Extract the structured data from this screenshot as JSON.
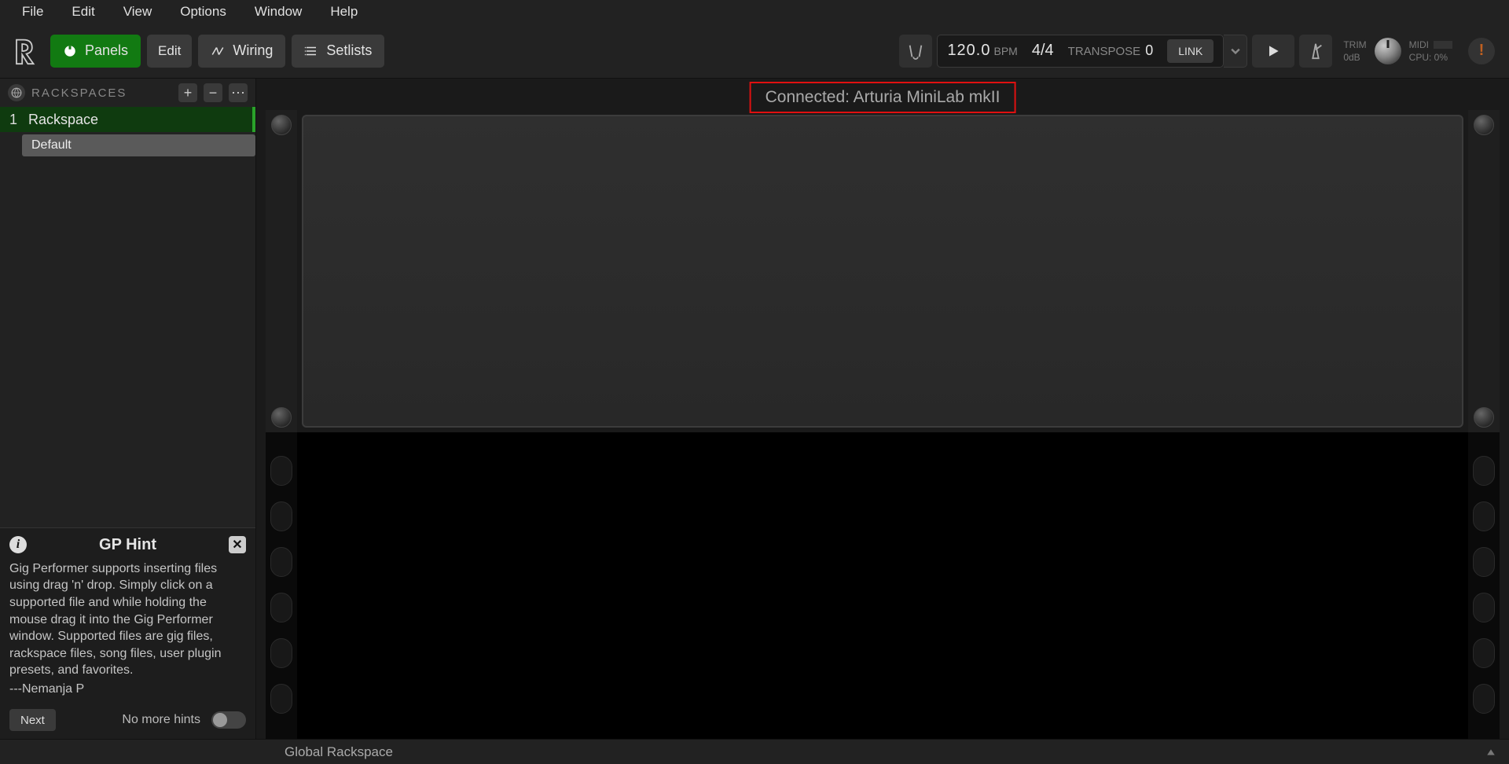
{
  "menu": {
    "items": [
      "File",
      "Edit",
      "View",
      "Options",
      "Window",
      "Help"
    ]
  },
  "toolbar": {
    "panels": "Panels",
    "edit": "Edit",
    "wiring": "Wiring",
    "setlists": "Setlists"
  },
  "status": {
    "bpm_value": "120.0",
    "bpm_label": "BPM",
    "time_sig": "4/4",
    "transpose_label": "TRANSPOSE",
    "transpose_value": "0",
    "link": "LINK",
    "trim": "TRIM",
    "trim_value": "0dB",
    "midi": "MIDI",
    "cpu": "CPU:  0%"
  },
  "sidebar": {
    "title": "RACKSPACES",
    "add": "+",
    "remove": "−",
    "more": "⋯",
    "rackspace": {
      "index": "1",
      "name": "Rackspace"
    },
    "variation": "Default"
  },
  "hint": {
    "title": "GP Hint",
    "body": "Gig Performer supports inserting files using drag 'n' drop. Simply click on a supported file and while holding the mouse drag it into the Gig Performer window. Supported files are gig files, rackspace files, song files, user plugin presets, and favorites.",
    "author": "---Nemanja P",
    "next": "Next",
    "no_more": "No more hints"
  },
  "notification": "Connected: Arturia MiniLab mkII",
  "footer": {
    "global": "Global Rackspace"
  }
}
